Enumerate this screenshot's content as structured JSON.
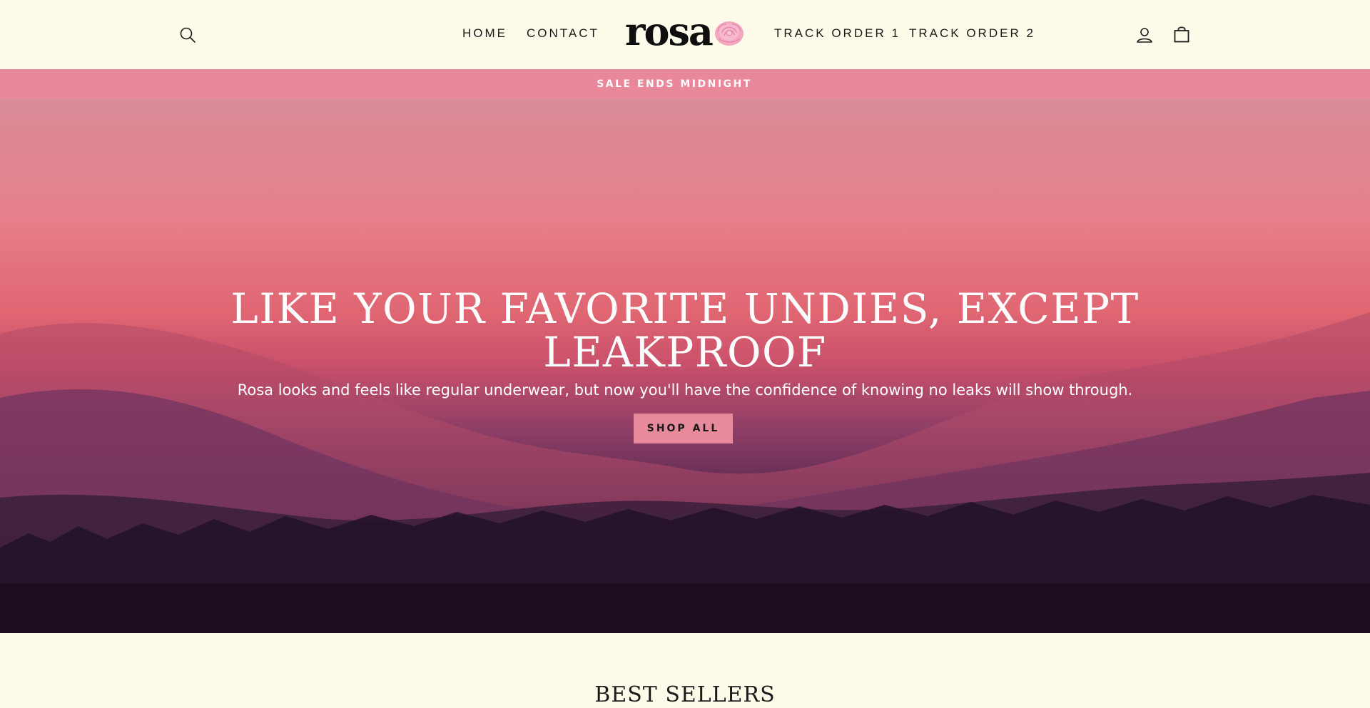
{
  "header": {
    "search_icon": "search-icon",
    "nav_left": [
      {
        "label": "HOME"
      },
      {
        "label": "CONTACT"
      }
    ],
    "logo": {
      "text": "rosa",
      "icon": "rose-icon",
      "rose_color": "#f4a7c0"
    },
    "nav_right": [
      {
        "label": "TRACK ORDER 1"
      },
      {
        "label": "TRACK ORDER 2"
      }
    ],
    "account_icon": "user-icon",
    "cart_icon": "shopping-bag-icon"
  },
  "announcement": {
    "text": "SALE ENDS MIDNIGHT",
    "background": "#e8889a"
  },
  "hero": {
    "title": "LIKE YOUR FAVORITE UNDIES, EXCEPT LEAKPROOF",
    "subtitle": "Rosa looks and feels like regular underwear, but now you'll have the confidence of knowing no leaks will show through.",
    "cta_label": "SHOP ALL",
    "cta_color": "#e68a9c"
  },
  "best_sellers": {
    "title": "BEST SELLERS"
  },
  "colors": {
    "page_background": "#fefbea",
    "text": "#1a1a1a"
  }
}
